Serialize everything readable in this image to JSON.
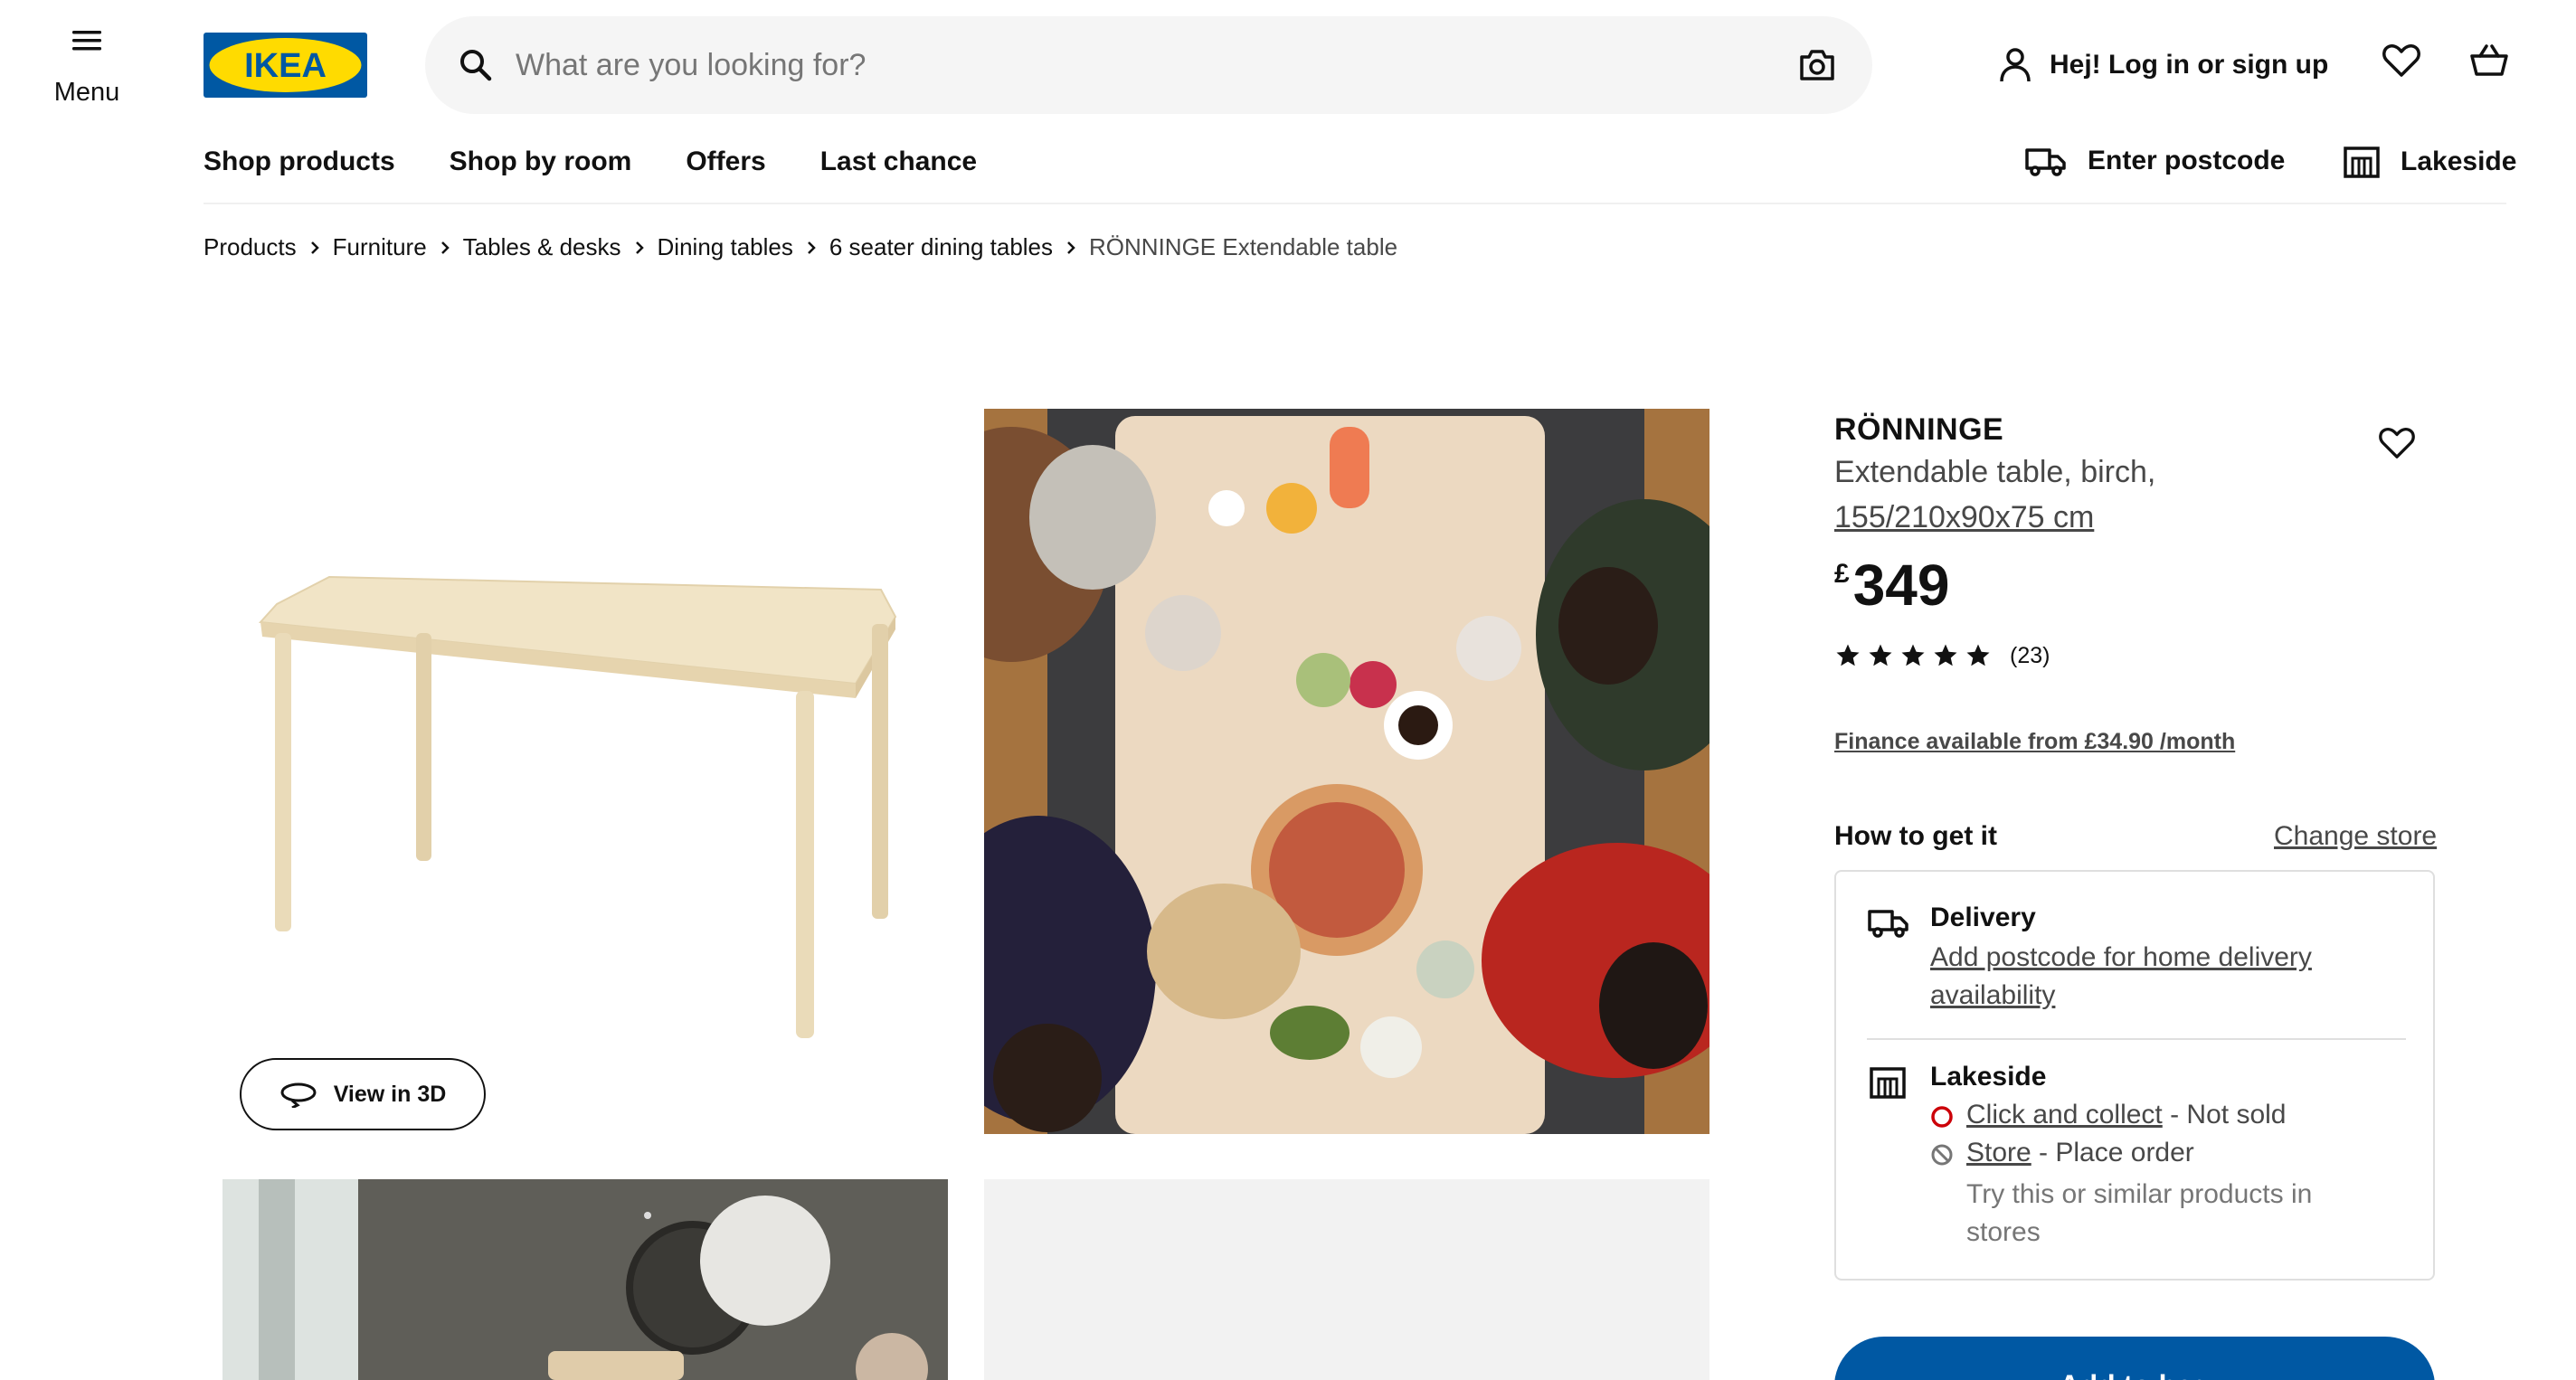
{
  "header": {
    "menu_label": "Menu",
    "logo_text": "IKEA",
    "search_placeholder": "What are you looking for?",
    "login_label": "Hej! Log in or sign up"
  },
  "nav": {
    "items": [
      "Shop products",
      "Shop by room",
      "Offers",
      "Last chance"
    ],
    "postcode_label": "Enter postcode",
    "store_label": "Lakeside"
  },
  "breadcrumb": [
    "Products",
    "Furniture",
    "Tables & desks",
    "Dining tables",
    "6 seater dining tables",
    "RÖNNINGE Extendable table"
  ],
  "gallery": {
    "view_3d_label": "View in 3D"
  },
  "product": {
    "name": "RÖNNINGE",
    "description": "Extendable table, birch,",
    "dimensions": "155/210x90x75 cm",
    "currency": "£",
    "price": "349",
    "rating_stars": 5,
    "rating_count": "(23)",
    "finance_text": "Finance available from £34.90 /month"
  },
  "availability": {
    "heading": "How to get it",
    "change_store_label": "Change store",
    "delivery": {
      "title": "Delivery",
      "link": "Add postcode for home delivery availability"
    },
    "store": {
      "title": "Lakeside",
      "click_collect_link": "Click and collect",
      "click_collect_status": " - Not sold",
      "store_link": "Store",
      "store_status": " - Place order",
      "note": "Try this or similar products in stores"
    },
    "add_to_bag_label": "Add to bag"
  },
  "colors": {
    "ikea_blue": "#0058a3",
    "ikea_yellow": "#ffdb00",
    "not_sold_red": "#cc0008",
    "text_grey": "#484848"
  }
}
